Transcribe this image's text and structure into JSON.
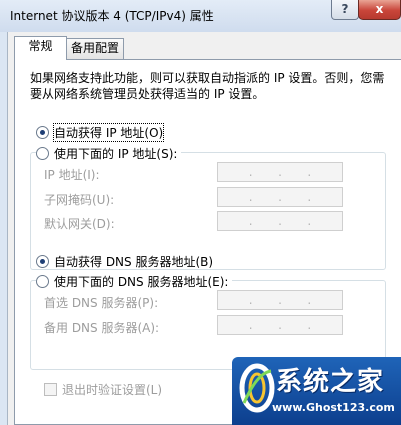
{
  "window": {
    "title": "Internet 协议版本 4 (TCP/IPv4) 属性",
    "help_label": "?",
    "close_label": "x"
  },
  "tabs": [
    {
      "label": "常规",
      "active": true
    },
    {
      "label": "备用配置",
      "active": false
    }
  ],
  "description": "如果网络支持此功能，则可以获取自动指派的 IP 设置。否则，您需要从网络系统管理员处获得适当的 IP 设置。",
  "ip_section": {
    "auto_option": {
      "label": "自动获得 IP 地址(O)",
      "selected": true
    },
    "manual_option": {
      "label": "使用下面的 IP 地址(S):",
      "selected": false
    },
    "fields": [
      {
        "label": "IP 地址(I):",
        "value": ". . ."
      },
      {
        "label": "子网掩码(U):",
        "value": ". . ."
      },
      {
        "label": "默认网关(D):",
        "value": ". . ."
      }
    ]
  },
  "dns_section": {
    "auto_option": {
      "label": "自动获得 DNS 服务器地址(B)",
      "selected": true
    },
    "manual_option": {
      "label": "使用下面的 DNS 服务器地址(E):",
      "selected": false
    },
    "fields": [
      {
        "label": "首选 DNS 服务器(P):",
        "value": ". . ."
      },
      {
        "label": "备用 DNS 服务器(A):",
        "value": ". . ."
      }
    ]
  },
  "validate_checkbox": {
    "label": "退出时验证设置(L)",
    "checked": false
  },
  "watermark": {
    "title": "系统之家",
    "url": "www.Ghost123.com"
  },
  "colors": {
    "title_bar": "#cfdcee",
    "dialog_bg": "#f0f0f0",
    "disabled_text": "#9d9d9d",
    "watermark_bg": "#0d3f8e",
    "close_button": "#c9453a"
  }
}
